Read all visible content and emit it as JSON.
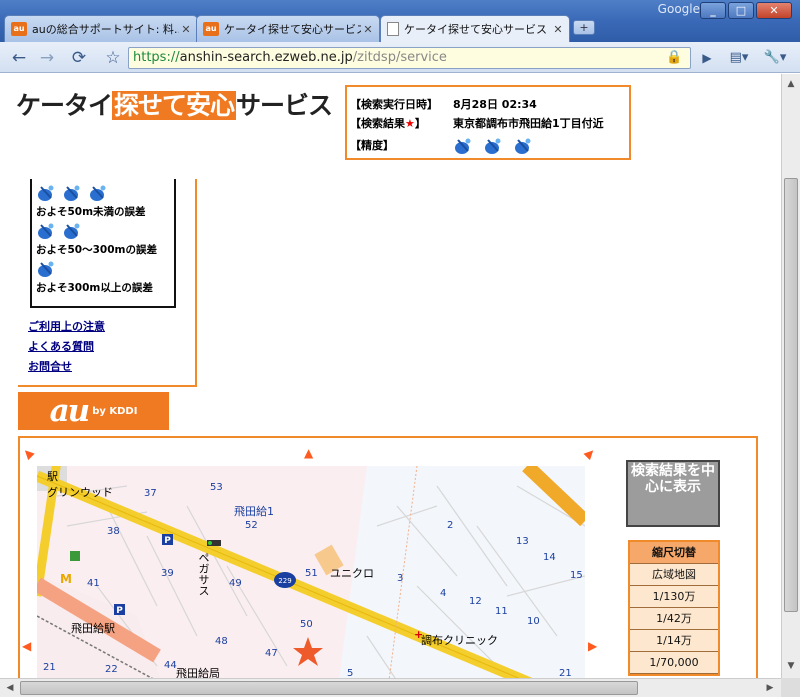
{
  "window": {
    "brand": "Google",
    "controls": [
      "_",
      "□",
      "✕"
    ]
  },
  "tabs": [
    {
      "title": "auの総合サポートサイト: 料…",
      "favicon": "au"
    },
    {
      "title": "ケータイ探せて安心サービス |…",
      "favicon": "au"
    },
    {
      "title": "ケータイ探せて安心サービス",
      "favicon": "page",
      "active": true
    }
  ],
  "toolbar": {
    "back": "←",
    "forward": "→",
    "reload": "⟳",
    "bookmark": "☆",
    "url_scheme": "https://",
    "url_host": "anshin-search.ezweb.ne.jp",
    "url_path": "/zitdsp/service",
    "go": "▶",
    "page_menu": "▤▾",
    "wrench_menu": "🔧▾"
  },
  "page": {
    "logo_prefix": "ケータイ",
    "logo_highlight": "探せて安心",
    "logo_suffix": "サービス",
    "info": {
      "time_label": "【検索実行日時】",
      "time_value": "8月28日 02:34",
      "result_label_pre": "【検索結果",
      "result_star": "★",
      "result_label_post": "】",
      "result_value": "東京都調布市飛田給1丁目付近",
      "accuracy_label": "【精度】",
      "accuracy_level": 3
    },
    "legend": {
      "high": "およそ50m未満の誤差",
      "mid": "およそ50～300mの誤差",
      "low": "およそ300m以上の誤差"
    },
    "links": [
      "ご利用上の注意",
      "よくある質問",
      "お問合せ"
    ],
    "au_logo": "au",
    "au_by": "by KDDI",
    "map_labels": {
      "station_top": "駅",
      "greenwood": "グリンウッド",
      "tobitakyu": "飛田給1",
      "pegasus": "ペガサス",
      "uniqlo": "ユニクロ",
      "chofu_clinic": "調布クリニック",
      "tobitakyu_sta": "飛田給駅",
      "tobitakyu_bureau": "飛田給局",
      "route": "229",
      "blocks": [
        "37",
        "53",
        "38",
        "52",
        "39",
        "51",
        "41",
        "49",
        "48",
        "47",
        "50",
        "21",
        "22",
        "44",
        "2",
        "3",
        "4",
        "12",
        "11",
        "10",
        "13",
        "14",
        "15",
        "5",
        "21"
      ]
    },
    "center_button": "検索結果を中心に表示",
    "scale": {
      "header": "縮尺切替",
      "options": [
        "広域地図",
        "1/130万",
        "1/42万",
        "1/14万",
        "1/70,000"
      ]
    }
  }
}
